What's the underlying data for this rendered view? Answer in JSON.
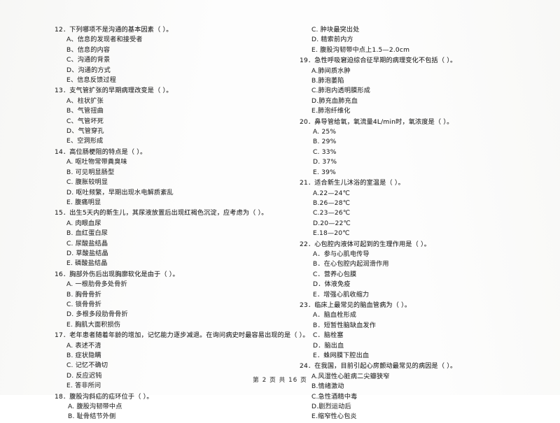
{
  "document": {
    "type": "scanned-exam-paper",
    "footer": "第 2 页  共 16 页"
  },
  "left_column": {
    "questions": [
      {
        "stem": "12．下列哪项不是沟通的基本因素（      ）。",
        "options": [
          "A、信息的发现者和接受者",
          "B、信息的内容",
          "C、沟通的背景",
          "D、沟通的方式",
          "E、信息反馈过程"
        ]
      },
      {
        "stem": "13．支气管扩张的早期病理改变是（      ）。",
        "options": [
          "A、柱状扩张",
          "B、气管扭曲",
          "C、气管坏死",
          "D、气管穿孔",
          "E、空洞形成"
        ]
      },
      {
        "stem": "14．高位肠梗阻的特点是（      ）。",
        "options": [
          "A. 呕吐物常带粪臭味",
          "B. 可见明显肠型",
          "C. 腹胀较明显",
          "D. 呕吐频繁，早期出现水电解质紊乱",
          "E. 腹痛明显"
        ]
      },
      {
        "stem": "15．出生5天内的新生儿，其尿液放置后出现红褐色沉淀，应考虑为（      ）。",
        "options": [
          "A. 肉眼血尿",
          "B. 血红蛋白尿",
          "C. 尿酸盐结晶",
          "D. 草酸盐结晶",
          "E. 磷酸盐结晶"
        ]
      },
      {
        "stem": "16．胸部外伤后出现胸廓软化是由于（      ）。",
        "options": [
          "A. 一根肋骨多处骨折",
          "B. 胸骨骨折",
          "C. 锁骨骨折",
          "D. 多根多段肋骨骨折",
          "E. 胸肌大面积损伤"
        ]
      },
      {
        "stem": "17．老年患者随着年龄的增加，记忆能力逐步减退。在询问病史时最容易出现的是（      ）。",
        "options": [
          "A. 表述不清",
          "B. 症状隐瞒",
          "C. 记忆不确切",
          "D. 反应迟钝",
          "E. 答非所问"
        ]
      },
      {
        "stem": "18．腹股沟斜疝的疝环位于（      ）。",
        "options": [
          "A.  腹股沟韧带中点",
          "B.  耻骨结节外侧"
        ]
      }
    ]
  },
  "right_column": {
    "continued_options": [
      "C.  肿块最突出处",
      "D.  精索前内方",
      "E.  腹股沟韧带中点上1.5—2.0cm"
    ],
    "questions": [
      {
        "stem": "19．急性呼吸窘迫综合征早期的病理变化不包括（      ）。",
        "options": [
          "A.肺间质水肿",
          "B.肺泡萎陷",
          "C.肺泡内透明膜形成",
          "D.肺充血肺充血",
          "E.肺泡纤维化"
        ]
      },
      {
        "stem": "20．鼻导管给氧，氧流量4L/min时，氧浓度是（      ）。",
        "options": [
          "A.  25%",
          "B.  29%",
          "C.  33%",
          "D.  37%",
          "E.  39%"
        ]
      },
      {
        "stem": "21．适合新生儿沐浴的室温是（      ）。",
        "options": [
          "A.22—24℃",
          "B.26—28℃",
          "C.23—26℃",
          "D.20—22℃",
          "E.18—20℃"
        ]
      },
      {
        "stem": "22．心包腔内液体可起到的生理作用是（      ）。",
        "options": [
          "A．参与心肌电传导",
          "B．在心包腔内起润滑作用",
          "C．营养心包膜",
          "D．体液免疫",
          "E．增强心肌收缩力"
        ]
      },
      {
        "stem": "23．临床上最常见的脑血管病为（      ）。",
        "options": [
          "A．脑血栓形成",
          "B．短暂性脑缺血发作",
          "C．脑栓塞",
          "D．脑出血",
          "E．蛛网膜下腔出血"
        ]
      },
      {
        "stem": "24．在我国，目前引起心房颤动最常见的病因是（      ）。",
        "options": [
          "A.风湿性心脏病二尖瓣狭窄",
          "B.情绪激动",
          "C.急性酒精中毒",
          "D.剧烈运动后",
          "E.缩窄性心包炎"
        ]
      }
    ]
  }
}
